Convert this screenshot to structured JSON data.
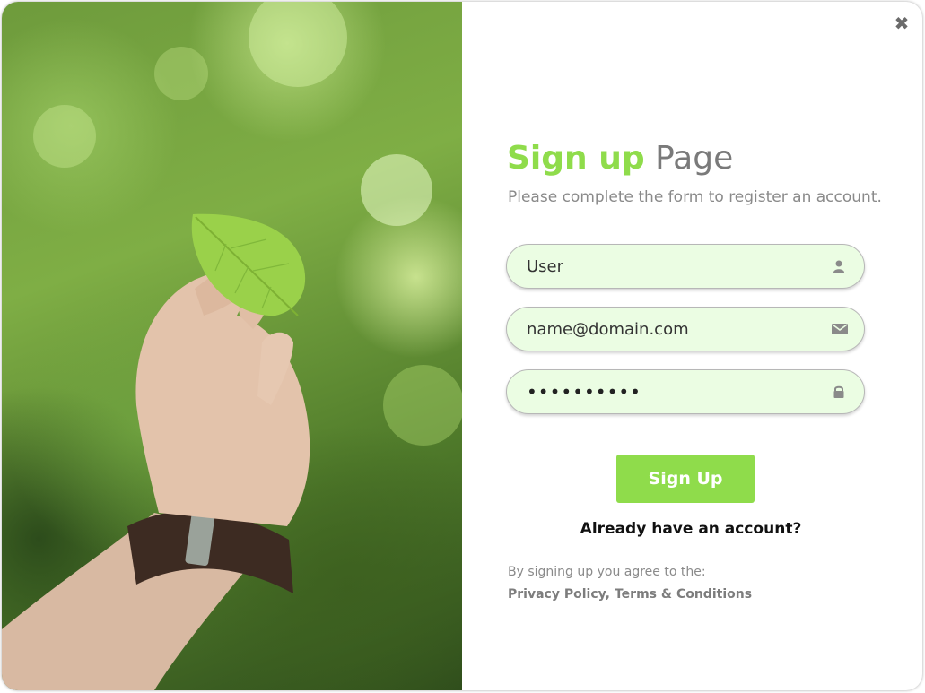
{
  "modal": {
    "close_icon": "close-icon",
    "close_glyph": "✖"
  },
  "photo": {
    "subject": "hand holding a green leaf",
    "colors": {
      "accent": "#8fdc4b",
      "field_bg": "#ebfde3"
    }
  },
  "form": {
    "title_accent": "Sign up",
    "title_rest": "Page",
    "subtitle": "Please complete the form to register an account.",
    "fields": [
      {
        "name": "user",
        "value": "User",
        "icon": "user-icon"
      },
      {
        "name": "email",
        "value": "name@domain.com",
        "icon": "envelope-icon"
      },
      {
        "name": "password",
        "value": "••••••••••",
        "icon": "lock-icon"
      }
    ],
    "submit_label": "Sign Up",
    "login_prompt": "Already have an account?",
    "agree_text": "By signing up you agree to the:",
    "privacy_label": "Privacy Policy",
    "separator": ",",
    "terms_label": "Terms & Conditions"
  }
}
